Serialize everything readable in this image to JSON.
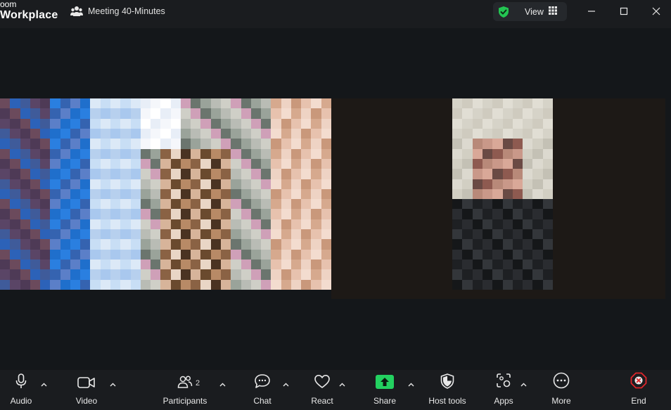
{
  "app": {
    "logo_line1": "oom",
    "logo_line2": "Workplace",
    "meeting_title": "Meeting 40-Minutes",
    "view_label": "View"
  },
  "window_controls": [
    "minimize",
    "maximize",
    "close"
  ],
  "participants_count": "2",
  "toolbar": {
    "audio": "Audio",
    "video": "Video",
    "participants": "Participants",
    "chat": "Chat",
    "react": "React",
    "share": "Share",
    "host_tools": "Host tools",
    "apps": "Apps",
    "more": "More",
    "end": "End"
  },
  "icons": {
    "meeting": "participants-group-icon",
    "security": "shield-check-icon",
    "view": "grid-icon",
    "audio": "microphone-icon",
    "video": "camera-icon",
    "participants": "people-icon",
    "chat": "chat-bubble-icon",
    "react": "heart-icon",
    "share": "share-arrow-icon",
    "host_tools": "shield-icon",
    "apps": "apps-icon",
    "more": "ellipsis-icon",
    "end": "end-hexagon-icon"
  },
  "colors": {
    "background": "#1a1c1f",
    "stage": "#14171a",
    "share_accent": "#23d160",
    "security_accent": "#23c552",
    "end_accent": "#e0252a"
  }
}
